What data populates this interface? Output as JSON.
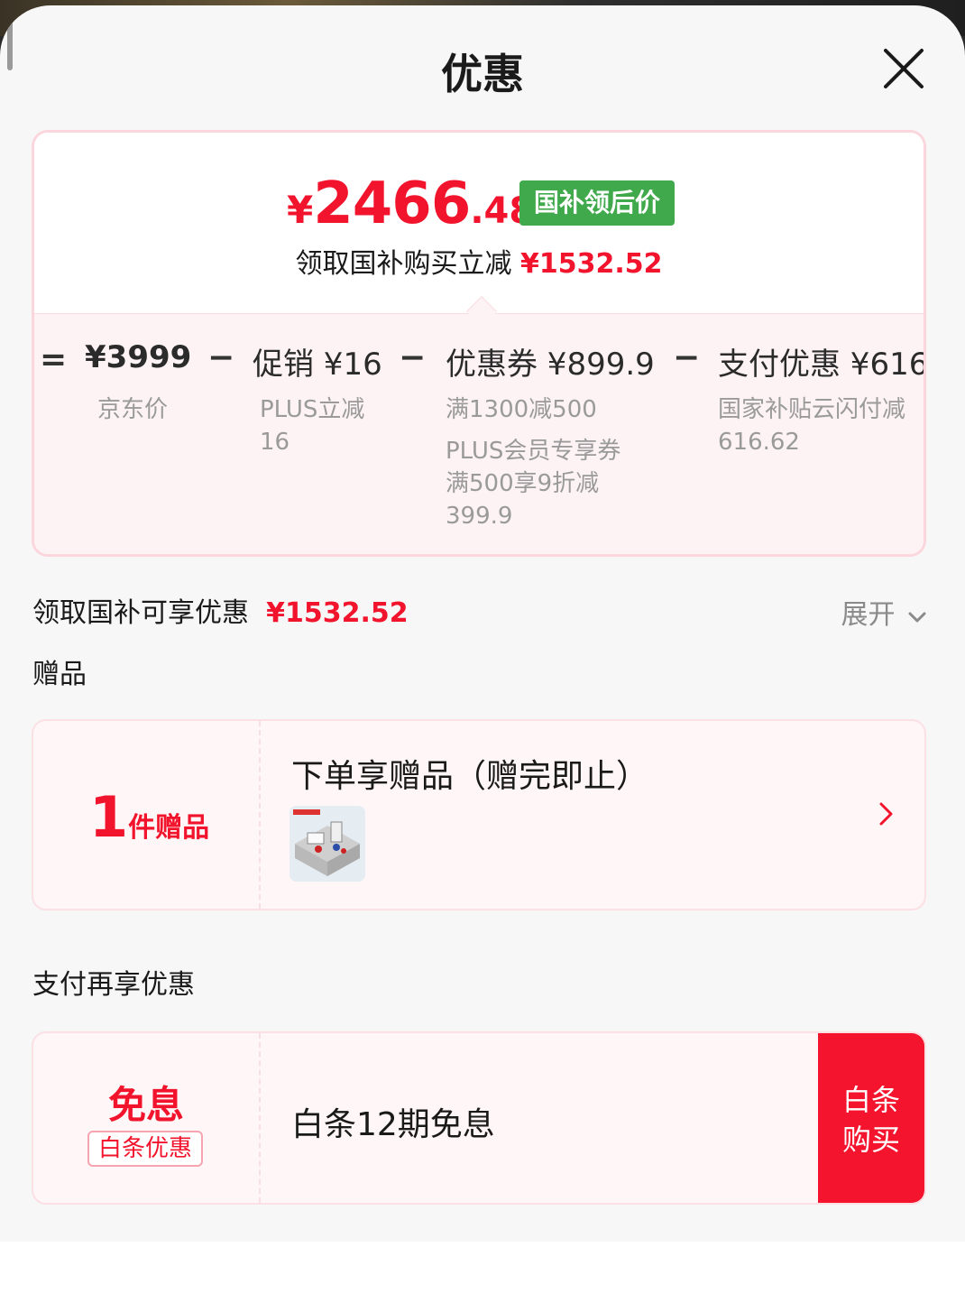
{
  "header": {
    "title": "优惠"
  },
  "price_card": {
    "currency": "¥",
    "price_int": "2466",
    "price_dec": ".48",
    "badge": "国补领后价",
    "subtitle": "领取国补购买立减",
    "subtitle_amount": "¥1532.52"
  },
  "formula": [
    {
      "op": "=",
      "title": "¥3999",
      "desc": [
        "京东价"
      ]
    },
    {
      "op": "−",
      "title": "促销 ¥16",
      "desc": [
        "PLUS立减",
        "16"
      ]
    },
    {
      "op": "−",
      "title": "优惠券 ¥899.9",
      "desc": [
        "满1300减500",
        "PLUS会员专享券",
        "满500享9折减",
        "399.9"
      ]
    },
    {
      "op": "−",
      "title": "支付优惠 ¥616.",
      "desc": [
        "国家补贴云闪付减",
        "616.62"
      ]
    }
  ],
  "discount_row": {
    "label": "领取国补可享优惠",
    "amount": "¥1532.52",
    "expand": "展开"
  },
  "gifts_section": {
    "label": "赠品"
  },
  "gift_card": {
    "count": "1",
    "count_unit": "件赠品",
    "title": "下单享赠品（赠完即止）"
  },
  "pay_section": {
    "label": "支付再享优惠"
  },
  "pay_card": {
    "free": "免息",
    "tag": "白条优惠",
    "title": "白条12期免息",
    "btn_line1": "白条",
    "btn_line2": "购买"
  },
  "colors": {
    "accent_red": "#f2142c",
    "badge_green": "#3fa94b",
    "button_red": "#f5142d"
  },
  "icons": {
    "close": "close-icon",
    "expand": "chevron-down-icon",
    "gift_arrow": "chevron-right-icon"
  }
}
